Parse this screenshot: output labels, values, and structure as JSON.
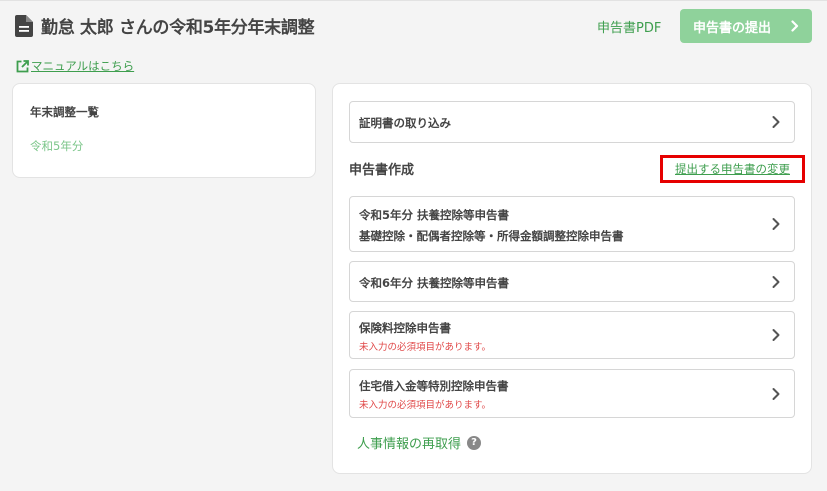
{
  "header": {
    "title": "勤怠 太郎 さんの令和5年分年末調整",
    "pdf_label": "申告書PDF",
    "submit_label": "申告書の提出"
  },
  "manual_link": "マニュアルはこちら",
  "sidebar": {
    "title": "年末調整一覧",
    "items": [
      {
        "label": "令和5年分"
      }
    ]
  },
  "main": {
    "import_label": "証明書の取り込み",
    "section_title": "申告書作成",
    "change_link": "提出する申告書の変更",
    "forms": [
      {
        "title": "令和5年分 扶養控除等申告書",
        "subtitle": "基礎控除・配偶者控除等・所得金額調整控除申告書"
      },
      {
        "title": "令和6年分 扶養控除等申告書"
      },
      {
        "title": "保険料控除申告書",
        "warning": "未入力の必須項目があります。"
      },
      {
        "title": "住宅借入金等特別控除申告書",
        "warning": "未入力の必須項目があります。"
      }
    ],
    "reacquire_label": "人事情報の再取得",
    "help_glyph": "?"
  },
  "colors": {
    "accent_green": "#3e9e4e",
    "submit_disabled": "#8fd29b",
    "warning_red": "#e04848",
    "highlight_red": "#e60000"
  },
  "icons": {
    "title": "document-icon",
    "manual": "external-link-icon",
    "row": "chevron-right-icon",
    "help": "help-icon"
  }
}
